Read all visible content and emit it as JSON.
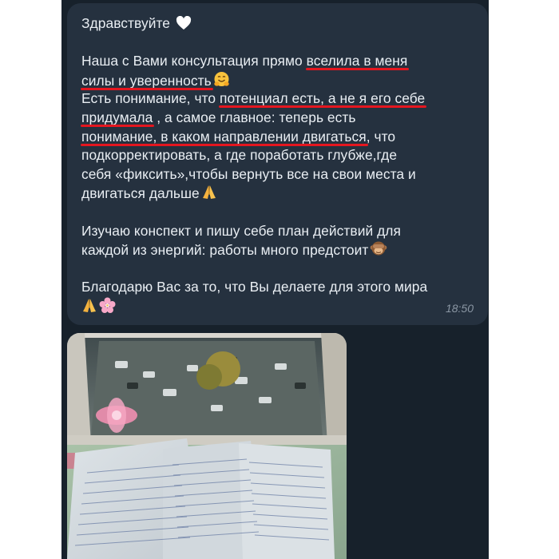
{
  "message": {
    "greeting": "Здравствуйте",
    "p1": {
      "l1_a": "Наша с Вами консультация прямо ",
      "l1_u": "вселила в меня",
      "l2_u": "силы и уверенность",
      "l3_a": "Есть понимание, что ",
      "l3_u": "потенциал есть, а не я его себе",
      "l4_u": "придумала",
      "l4_b": " , а самое главное: теперь есть",
      "l5_u": "понимание, в каком направлении двигаться",
      "l5_b": ", что",
      "l6": "подкорректировать, а где поработать глубже,где",
      "l7": "себя «фиксить»,чтобы вернуть все на свои места и",
      "l8": "двигаться дальше"
    },
    "p2": {
      "l1": "Изучаю конспект и пишу себе план действий для",
      "l2": "каждой из энергий: работы много предстоит"
    },
    "p3": {
      "l1": "Благодарю Вас за то, что Вы делаете для этого мира"
    },
    "time": "18:50"
  },
  "icons": [
    "white-heart-icon",
    "hugging-face-icon",
    "folded-hands-icon",
    "see-no-evil-monkey-icon",
    "cherry-blossom-icon"
  ],
  "colors": {
    "chat_background": "#17212b",
    "bubble": "#25313f",
    "text": "#e9eef3",
    "underline": "#e5161f",
    "timestamp": "#8a96a3"
  }
}
